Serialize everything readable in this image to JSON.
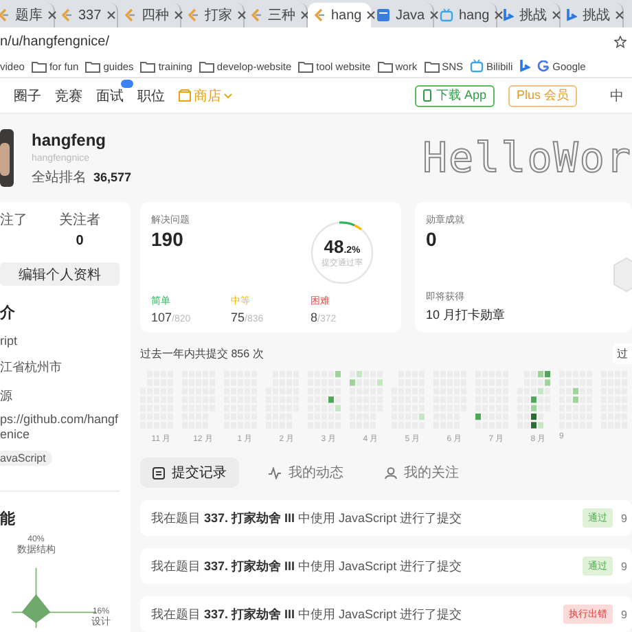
{
  "browser": {
    "tabs": [
      {
        "label": "题库",
        "kind": "leetcode",
        "selected": false
      },
      {
        "label": "337",
        "kind": "leetcode",
        "selected": false
      },
      {
        "label": "四种",
        "kind": "leetcode",
        "selected": false
      },
      {
        "label": "打家",
        "kind": "leetcode",
        "selected": false
      },
      {
        "label": "三种",
        "kind": "leetcode",
        "selected": false
      },
      {
        "label": "hang",
        "kind": "leetcode",
        "selected": true
      },
      {
        "label": "Java",
        "kind": "doc",
        "selected": false
      },
      {
        "label": "hang",
        "kind": "tv",
        "selected": false
      },
      {
        "label": "挑战",
        "kind": "bing",
        "selected": false
      },
      {
        "label": "挑战",
        "kind": "bing",
        "selected": false
      }
    ],
    "address": "n/u/hangfengnice/",
    "bookmarks": [
      {
        "label": "video",
        "kind": "plain"
      },
      {
        "label": "for fun",
        "kind": "folder"
      },
      {
        "label": "guides",
        "kind": "folder"
      },
      {
        "label": "training",
        "kind": "folder"
      },
      {
        "label": "develop-website",
        "kind": "folder"
      },
      {
        "label": "tool website",
        "kind": "folder"
      },
      {
        "label": "work",
        "kind": "folder"
      },
      {
        "label": "SNS",
        "kind": "folder"
      },
      {
        "label": "Bilibili",
        "kind": "tv"
      },
      {
        "kind": "bing"
      },
      {
        "label": "Google",
        "kind": "google"
      }
    ]
  },
  "site_nav": {
    "items": [
      {
        "label": "圈子",
        "kind": "plain"
      },
      {
        "label": "竞赛",
        "kind": "plain"
      },
      {
        "label": "面试",
        "kind": "badged"
      },
      {
        "label": "职位",
        "kind": "plain"
      },
      {
        "label": "商店",
        "kind": "store"
      }
    ],
    "app_button": "下载 App",
    "plus_button": "Plus 会员",
    "language": "中"
  },
  "profile": {
    "name": "hangfeng",
    "handle": "hangfengnice",
    "rank_label": "全站排名",
    "rank": "36,577",
    "banner": "HelloWor"
  },
  "sidebar": {
    "follow": [
      {
        "label": "注了"
      },
      {
        "label": "关注者",
        "value": "0"
      }
    ],
    "edit_button": "编辑个人资料",
    "intro_title": "介",
    "intro": [
      "ript",
      "江省杭州市"
    ],
    "source_label": "源",
    "link": "ps://github.com/hangfenice",
    "tag": "avaScript",
    "skills_title": "能",
    "radar_labels": [
      {
        "value": "40%",
        "name": "数据结构"
      },
      {
        "value": "16%",
        "name": "设计"
      }
    ]
  },
  "solved": {
    "label": "解决问题",
    "count": "190",
    "rate": "48",
    "rate_decimal": ".2%",
    "rate_label": "提交通过率",
    "levels": [
      {
        "name": "简单",
        "kind": "easy",
        "solved": "107",
        "total": "/820"
      },
      {
        "name": "中等",
        "kind": "medium",
        "solved": "75",
        "total": "/836"
      },
      {
        "name": "困难",
        "kind": "hard",
        "solved": "8",
        "total": "/372"
      }
    ]
  },
  "badges": {
    "label": "勋章成就",
    "count": "0",
    "next_label": "即将获得",
    "next": "10 月打卡勋章"
  },
  "activity": {
    "summary": "过去一年内共提交 856 次",
    "button": "过",
    "months": [
      "11 月",
      "12 月",
      "1 月",
      "2 月",
      "3 月",
      "4 月",
      "5 月",
      "6 月",
      "7 月",
      "8 月",
      "9"
    ]
  },
  "tabs": [
    {
      "label": "提交记录",
      "kind": "list",
      "selected": true
    },
    {
      "label": "我的动态",
      "kind": "pulse",
      "selected": false
    },
    {
      "label": "我的关注",
      "kind": "person",
      "selected": false
    }
  ],
  "records": [
    {
      "text": "我在题目 **337. 打家劫舍 III** 中使用 JavaScript 进行了提交",
      "status": "通过",
      "kind": "accepted",
      "time": "9"
    },
    {
      "text": "我在题目 **337. 打家劫舍 III** 中使用 JavaScript 进行了提交",
      "status": "通过",
      "kind": "accepted",
      "time": "9"
    },
    {
      "text": "我在题目 **337. 打家劫舍 III** 中使用 JavaScript 进行了提交",
      "status": "执行出错",
      "kind": "error",
      "time": "9"
    }
  ]
}
